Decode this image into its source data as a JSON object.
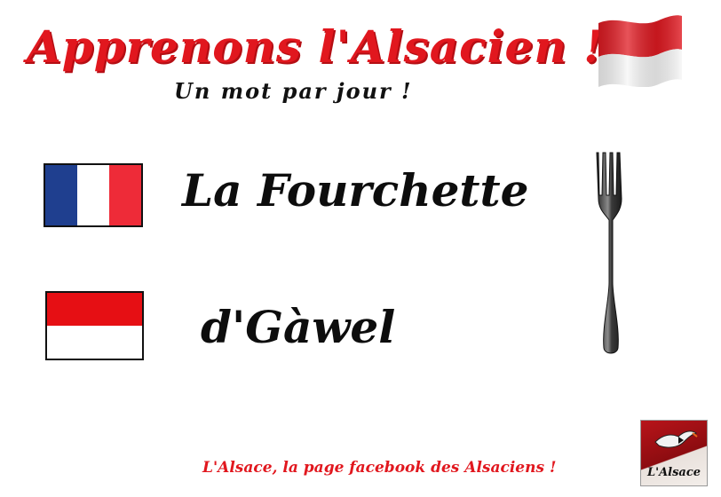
{
  "header": {
    "title": "Apprenons l'Alsacien !",
    "subtitle": "Un mot par jour !"
  },
  "words": {
    "french": "La Fourchette",
    "alsatian": "d'Gàwel"
  },
  "flags": {
    "header_flag": "alsace-flag",
    "french_flag": "france-flag",
    "alsatian_flag": "alsace-flag"
  },
  "illustration": "fork-icon",
  "footer": {
    "text": "L'Alsace, la page facebook des Alsaciens !",
    "badge_label": "L'Alsace"
  },
  "colors": {
    "accent_red": "#e1171e",
    "french_blue": "#1f3f8f",
    "french_white": "#ffffff",
    "french_red": "#ee2b38",
    "text_dark": "#0d0d0d"
  }
}
